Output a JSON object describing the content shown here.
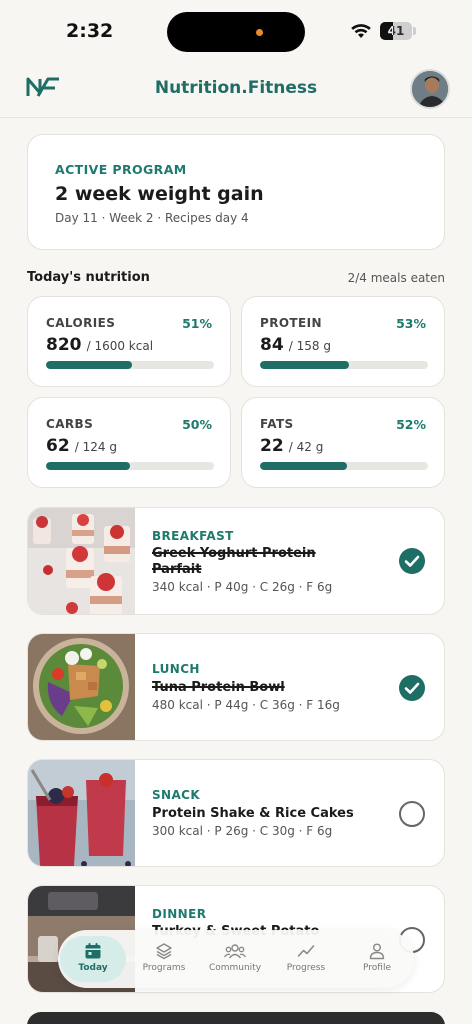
{
  "status_bar": {
    "time": "2:32",
    "battery": "41",
    "battery_fraction": 0.41
  },
  "header": {
    "title": "Nutrition.Fitness"
  },
  "program": {
    "label": "ACTIVE PROGRAM",
    "title": "2 week weight gain",
    "subtitle": "Day 11 · Week 2 · Recipes day 4"
  },
  "nutrition": {
    "title": "Today's nutrition",
    "meals_eaten": "2/4 meals eaten",
    "macros": [
      {
        "name": "CALORIES",
        "percent": "51%",
        "value": "820",
        "target": "/ 1600 kcal",
        "fraction": 0.51
      },
      {
        "name": "PROTEIN",
        "percent": "53%",
        "value": "84",
        "target": "/ 158 g",
        "fraction": 0.53
      },
      {
        "name": "CARBS",
        "percent": "50%",
        "value": "62",
        "target": "/ 124 g",
        "fraction": 0.5
      },
      {
        "name": "FATS",
        "percent": "52%",
        "value": "22",
        "target": "/ 42 g",
        "fraction": 0.52
      }
    ]
  },
  "meals": [
    {
      "type": "BREAKFAST",
      "name": "Greek Yoghurt Protein Parfait",
      "macros": "340 kcal · P 40g · C 26g · F 6g",
      "done": true
    },
    {
      "type": "LUNCH",
      "name": "Tuna Protein Bowl",
      "macros": "480 kcal · P 44g · C 36g · F 16g",
      "done": true
    },
    {
      "type": "SNACK",
      "name": "Protein Shake & Rice Cakes",
      "macros": "300 kcal · P 26g · C 30g · F 6g",
      "done": false
    },
    {
      "type": "DINNER",
      "name": "Turkey & Sweet Potato",
      "macros": "",
      "done": false
    }
  ],
  "tabs": [
    {
      "label": "Today",
      "icon": "calendar-icon",
      "active": true
    },
    {
      "label": "Programs",
      "icon": "layers-icon",
      "active": false
    },
    {
      "label": "Community",
      "icon": "people-icon",
      "active": false
    },
    {
      "label": "Progress",
      "icon": "trend-icon",
      "active": false
    },
    {
      "label": "Profile",
      "icon": "person-icon",
      "active": false
    }
  ],
  "colors": {
    "accent": "#1e6e66",
    "accent_text": "#1e7a6e",
    "background": "#f7f6f3"
  }
}
